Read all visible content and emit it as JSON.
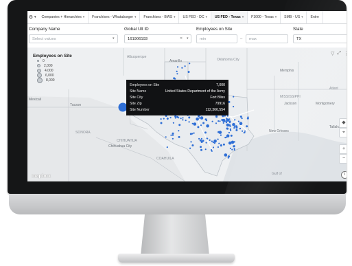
{
  "tabs": [
    {
      "label": "Companies + Hierarchies",
      "active": false
    },
    {
      "label": "Franchises - Whataburger",
      "active": false
    },
    {
      "label": "Franchises - BWS",
      "active": false
    },
    {
      "label": "US FED - DC",
      "active": false
    },
    {
      "label": "US FED - Texas",
      "active": true
    },
    {
      "label": "F1000 - Texas",
      "active": false
    },
    {
      "label": "SMB - US",
      "active": false
    },
    {
      "label": "Entre",
      "active": false
    }
  ],
  "filters": {
    "company_name": {
      "label": "Company Name",
      "placeholder": "Select values"
    },
    "global_ult_id": {
      "label": "Global Ult ID",
      "value": "161906193"
    },
    "employees_on_site": {
      "label": "Employees on Site",
      "min_placeholder": "min",
      "max_placeholder": "max",
      "dash": "–"
    },
    "state": {
      "label": "State",
      "value": "TX"
    }
  },
  "legend": {
    "title": "Employees on Site",
    "items": [
      "0",
      "2,000",
      "4,000",
      "6,000",
      "8,000"
    ]
  },
  "map_labels": {
    "albuquerque": "Albuquerque",
    "oklahoma_city": "Oklahoma City",
    "memphis": "Memphis",
    "atlanta": "Atlant",
    "mississippi": "MISSISSIPPI",
    "jackson": "Jackson",
    "montgomery": "Montgomery",
    "mexicali": "Mexicali",
    "tucson": "Tucson",
    "sonora": "SONORA",
    "chihuahua": "CHIHUAHUA",
    "chihuahua_city": "Chihuahua City",
    "coahuila": "COAHUILA",
    "new_orleans": "New Orleans",
    "tallahassee": "Tallahasse",
    "gulf_of": "Gulf of",
    "amarillo": "Amarillo"
  },
  "tooltip": {
    "rows": [
      {
        "key": "Employees on Site",
        "value": "7,000"
      },
      {
        "key": "Site Name",
        "value": "United States Department of the Army"
      },
      {
        "key": "Site City",
        "value": "Fort Bliss"
      },
      {
        "key": "Site Zip",
        "value": "79916"
      },
      {
        "key": "Site Number",
        "value": "112,366,554"
      }
    ]
  },
  "map_controls": {
    "zoom_in": "+",
    "zoom_out": "−",
    "locate": "⌖",
    "compass": "◆"
  },
  "attribution": "mapbox",
  "info": "i",
  "colors": {
    "dot": "#2f6fd6",
    "tooltip_bg": "#111214",
    "bezel": "#151617"
  }
}
